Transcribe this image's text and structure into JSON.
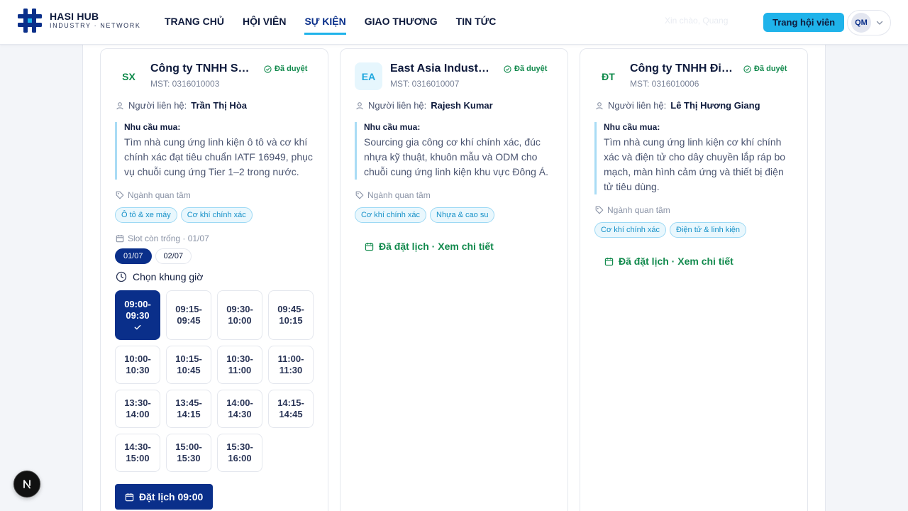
{
  "brand": {
    "name": "HASI HUB",
    "tagline": "INDUSTRY · NETWORK"
  },
  "nav": [
    {
      "label": "TRANG CHỦ",
      "active": false
    },
    {
      "label": "HỘI VIÊN",
      "active": false
    },
    {
      "label": "SỰ KIỆN",
      "active": true
    },
    {
      "label": "GIAO THƯƠNG",
      "active": false
    },
    {
      "label": "TIN TỨC",
      "active": false
    }
  ],
  "header": {
    "faded_text": "Xin chào, Quang",
    "member_button": "Trang hội viên",
    "user_initials": "QM"
  },
  "labels": {
    "contact_prefix": "Người liên hệ: ",
    "need_label": "Nhu cầu mua:",
    "interest_label": "Ngành quan tâm",
    "slot_label": "Slot còn trống · 01/07",
    "time_label": "Chọn khung giờ",
    "book_button": "Đặt lịch 09:00",
    "booked_text": "Đã đặt lịch · Xem chi tiết"
  },
  "cards": [
    {
      "initials": "SX",
      "name": "Công ty TNHH Sản xuất",
      "status": "Đã duyệt",
      "mst": "MST: 0316010003",
      "contact": "Trần Thị Hòa",
      "need": "Tìm nhà cung ứng linh kiện ô tô và cơ khí chính xác đạt tiêu chuẩn IATF 16949, phục vụ chuỗi cung ứng Tier 1–2 trong nước.",
      "tags": [
        "Ô tô & xe máy",
        "Cơ khí chính xác"
      ],
      "dates": [
        {
          "label": "01/07",
          "active": true
        },
        {
          "label": "02/07",
          "active": false
        }
      ],
      "slots": [
        {
          "start": "09:00-",
          "end": "09:30",
          "selected": true
        },
        {
          "start": "09:15-",
          "end": "09:45",
          "selected": false
        },
        {
          "start": "09:30-",
          "end": "10:00",
          "selected": false
        },
        {
          "start": "09:45-",
          "end": "10:15",
          "selected": false
        },
        {
          "start": "10:00-",
          "end": "10:30",
          "selected": false
        },
        {
          "start": "10:15-",
          "end": "10:45",
          "selected": false
        },
        {
          "start": "10:30-",
          "end": "11:00",
          "selected": false
        },
        {
          "start": "11:00-",
          "end": "11:30",
          "selected": false
        },
        {
          "start": "13:30-",
          "end": "14:00",
          "selected": false
        },
        {
          "start": "13:45-",
          "end": "14:15",
          "selected": false
        },
        {
          "start": "14:00-",
          "end": "14:30",
          "selected": false
        },
        {
          "start": "14:15-",
          "end": "14:45",
          "selected": false
        },
        {
          "start": "14:30-",
          "end": "15:00",
          "selected": false
        },
        {
          "start": "15:00-",
          "end": "15:30",
          "selected": false
        },
        {
          "start": "15:30-",
          "end": "16:00",
          "selected": false
        }
      ]
    },
    {
      "initials": "EA",
      "name": "East Asia Industrial Sourcing",
      "status": "Đã duyệt",
      "mst": "MST: 0316010007",
      "contact": "Rajesh Kumar",
      "need": "Sourcing gia công cơ khí chính xác, đúc nhựa kỹ thuật, khuôn mẫu và ODM cho chuỗi cung ứng linh kiện khu vực Đông Á.",
      "tags": [
        "Cơ khí chính xác",
        "Nhựa & cao su"
      ]
    },
    {
      "initials": "ĐT",
      "name": "Công ty TNHH Điện tử",
      "status": "Đã duyệt",
      "mst": "MST: 0316010006",
      "contact": "Lê Thị Hương Giang",
      "need": "Tìm nhà cung ứng linh kiện cơ khí chính xác và điện tử cho dây chuyền lắp ráp bo mạch, màn hình cảm ứng và thiết bị điện tử tiêu dùng.",
      "tags": [
        "Cơ khí chính xác",
        "Điện tử & linh kiện"
      ]
    }
  ]
}
